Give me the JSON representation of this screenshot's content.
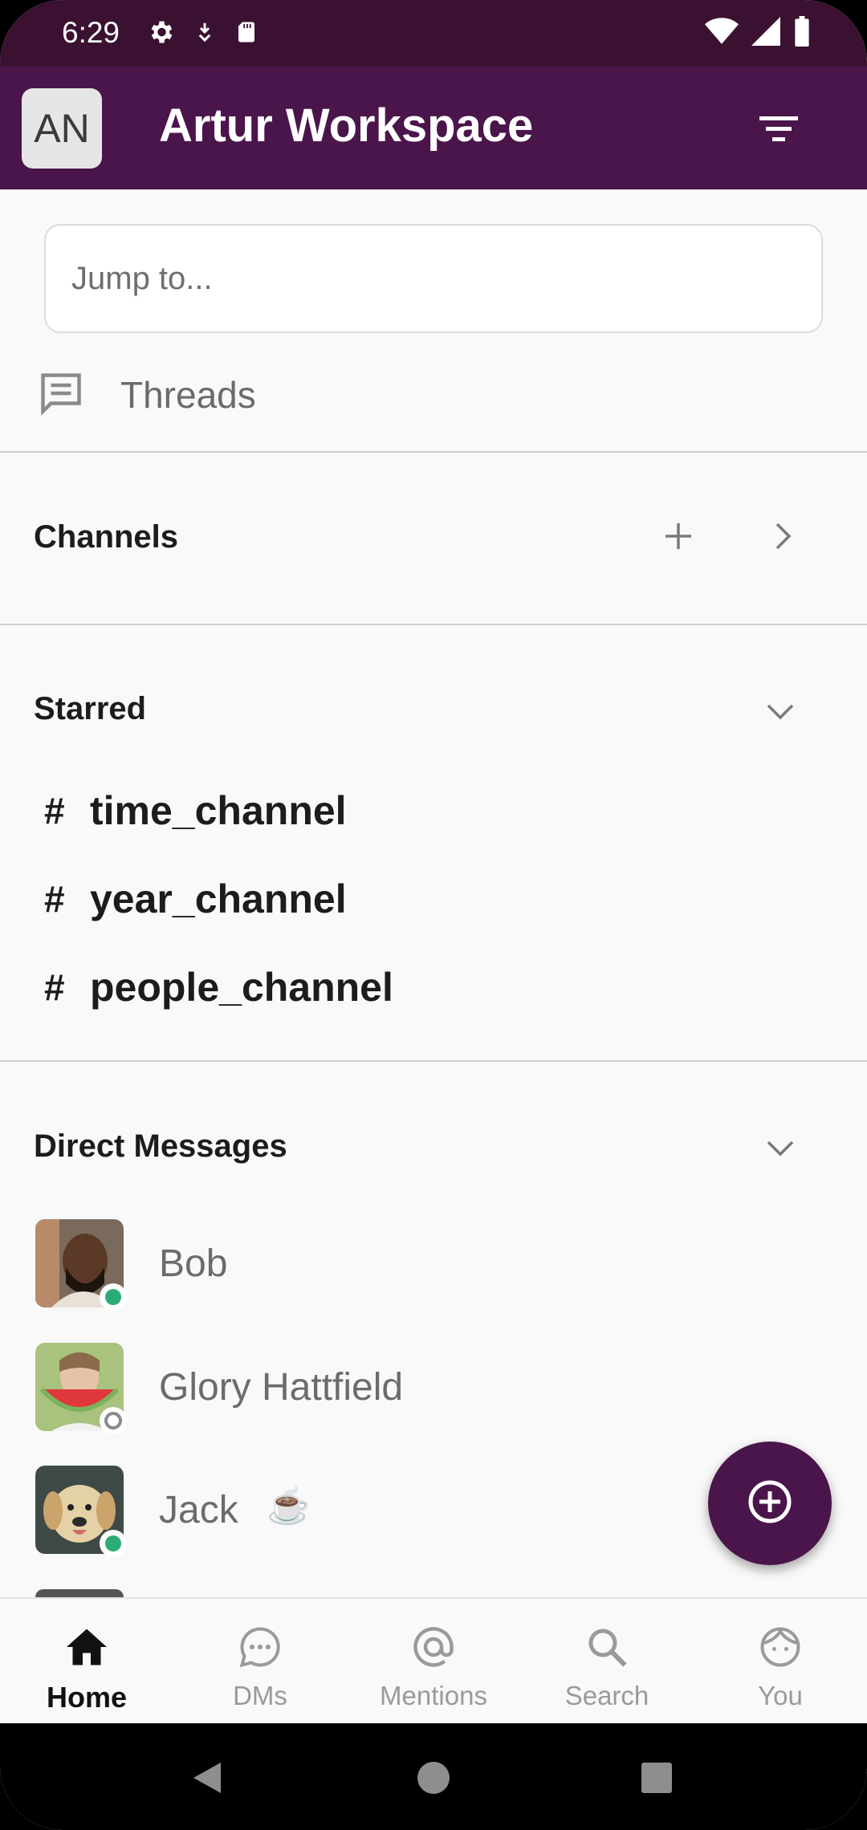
{
  "status_bar": {
    "time": "6:29"
  },
  "workspace": {
    "initials": "AN",
    "title": "Artur Workspace"
  },
  "jump": {
    "placeholder": "Jump to..."
  },
  "threads": {
    "label": "Threads"
  },
  "sections": {
    "channels": "Channels",
    "starred": "Starred",
    "direct_messages": "Direct Messages"
  },
  "starred_channels": [
    "time_channel",
    "year_channel",
    "people_channel"
  ],
  "channel_prefix": "#",
  "direct_messages": [
    {
      "name": "Bob",
      "presence": "online",
      "status_emoji": ""
    },
    {
      "name": "Glory Hattfield",
      "presence": "away",
      "status_emoji": ""
    },
    {
      "name": "Jack",
      "presence": "online",
      "status_emoji": "☕"
    }
  ],
  "bottom_nav": {
    "home": "Home",
    "dms": "DMs",
    "mentions": "Mentions",
    "search": "Search",
    "you": "You"
  },
  "colors": {
    "brand": "#4a154b",
    "status_bar": "#3b1132",
    "online": "#2bac76"
  }
}
